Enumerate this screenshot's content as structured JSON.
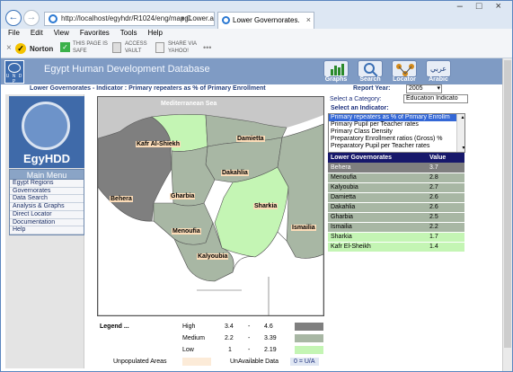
{
  "browser": {
    "url": "http://localhost/egyhdr/R1024/eng/mapgLower.as",
    "address_buttons": "▾ C",
    "tab_title": "Lower Governorates.",
    "tab_close": "×",
    "window_controls": "– □ ×",
    "back_arrow": "←",
    "forward_arrow": "→",
    "menu": [
      "File",
      "Edit",
      "View",
      "Favorites",
      "Tools",
      "Help"
    ],
    "toolbar": {
      "close_x": "×",
      "norton": "Norton",
      "safe_line1": "THIS PAGE IS",
      "safe_line2": "SAFE",
      "vault_line1": "ACCESS",
      "vault_line2": "VAULT",
      "share_line1": "SHARE VIA",
      "share_line2": "YAHOO!",
      "more": "•••"
    }
  },
  "header": {
    "title": "Egypt Human Development Database",
    "undp": "U N D P",
    "icons": [
      {
        "label": "Graphs",
        "icon": "bar-chart-icon"
      },
      {
        "label": "Search",
        "icon": "magnifier-icon"
      },
      {
        "label": "Locator",
        "icon": "network-icon"
      },
      {
        "label": "Arabic",
        "icon": "arabic-icon"
      }
    ],
    "arabic_glyph": "عربي"
  },
  "subheader": {
    "title": "Lower Governorates - Indicator : Primary repeaters as % of Primary Enrollment",
    "report_year_label": "Report Year:",
    "year": "2005"
  },
  "sidebar": {
    "logo_text": "EgyHDD",
    "menu_title": "Main Menu",
    "items": [
      "Egypt Regions",
      "Governorates",
      "Data Search",
      "Analysis & Graphs",
      "Direct Locator",
      "Documentation",
      "Help"
    ]
  },
  "map": {
    "sea_label": "Mediterranean Sea",
    "labels": [
      "Kafr Al-Shiekh",
      "Damietta",
      "Dakahlia",
      "Behera",
      "Gharbia",
      "Sharkia",
      "Ismailia",
      "Menoufia",
      "Kalyoubia"
    ]
  },
  "controls": {
    "category_label": "Select a Category:",
    "category_value": "Education Indicato",
    "indicator_label": "Select an Indicator:",
    "indicators": [
      "Primary repeaters as % of Primary Enrollm",
      "Primary Pupil per Teacher rates",
      "Primary Class Density",
      "Preparatory Enrollment ratios (Gross) %",
      "Preparatory Pupil per Teacher rates"
    ],
    "scroll_up": "▴",
    "scroll_down": "▾"
  },
  "table": {
    "headers": [
      "Lower Governorates",
      "Value"
    ],
    "rows": [
      {
        "name": "Behera",
        "value": "3.7",
        "level": "high"
      },
      {
        "name": "Menoufia",
        "value": "2.8",
        "level": "medium"
      },
      {
        "name": "Kalyoubia",
        "value": "2.7",
        "level": "medium"
      },
      {
        "name": "Damietta",
        "value": "2.6",
        "level": "medium"
      },
      {
        "name": "Dakahlia",
        "value": "2.6",
        "level": "medium"
      },
      {
        "name": "Gharbia",
        "value": "2.5",
        "level": "medium"
      },
      {
        "name": "Ismailia",
        "value": "2.2",
        "level": "medium"
      },
      {
        "name": "Sharkia",
        "value": "1.7",
        "level": "low"
      },
      {
        "name": "Kafr El-Sheikh",
        "value": "1.4",
        "level": "low"
      }
    ]
  },
  "legend": {
    "title": "Legend ...",
    "high": {
      "label": "High",
      "min": "3.4",
      "dash": "-",
      "max": "4.6"
    },
    "medium": {
      "label": "Medium",
      "min": "2.2",
      "dash": "-",
      "max": "3.39"
    },
    "low": {
      "label": "Low",
      "min": "1",
      "dash": "-",
      "max": "2.19"
    },
    "unpopulated": "Unpopulated Areas",
    "unavailable": "UnAvailable Data",
    "ua_note": "0 = U/A"
  },
  "colors": {
    "high": "#7f7f7f",
    "medium": "#a8b7a4",
    "low": "#c4f5b4",
    "unpopulated": "#fcebd8",
    "header": "#7f9bc4",
    "table_header": "#17186b",
    "selected_row": "#3367d6"
  }
}
